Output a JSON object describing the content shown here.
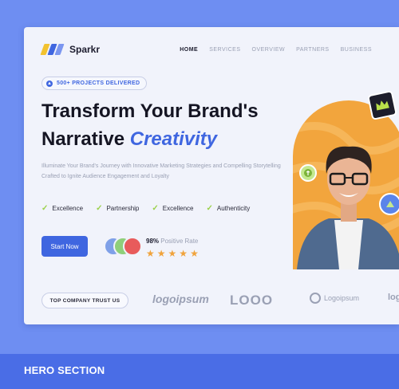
{
  "brand": {
    "name": "Sparkr"
  },
  "nav": {
    "items": [
      "HOME",
      "SERVICES",
      "OVERVIEW",
      "PARTNERS",
      "BUSINESS"
    ],
    "active": "HOME"
  },
  "pill": {
    "text": "500+ PROJECTS DELIVERED"
  },
  "hero": {
    "line1": "Transform Your Brand's",
    "line2_plain": "Narrative ",
    "line2_accent": "Creativity",
    "subtitle": "Illuminate Your Brand's Journey with Innovative Marketing Strategies and Compelling Storytelling Crafted to Ignite Audience Engagement and Loyalty"
  },
  "features": [
    "Excellence",
    "Partnership",
    "Excellence",
    "Authenticity"
  ],
  "cta": {
    "label": "Start Now"
  },
  "rating": {
    "percent": "98%",
    "text": "Positive Rate",
    "stars": 5
  },
  "trust": {
    "label": "TOP COMPANY TRUST US",
    "logos": [
      "logoipsum",
      "LOOO",
      "Logoipsum",
      "log"
    ]
  },
  "footer": {
    "label": "HERO SECTION"
  },
  "colors": {
    "primary": "#3f66e0",
    "accent_orange": "#f2a53d",
    "check": "#9bd14a",
    "star": "#f0a33c"
  }
}
